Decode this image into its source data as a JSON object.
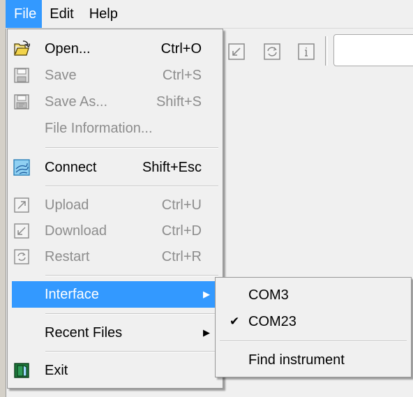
{
  "menubar": {
    "items": [
      {
        "label": "File"
      },
      {
        "label": "Edit"
      },
      {
        "label": "Help"
      }
    ]
  },
  "file_menu": {
    "open": {
      "label": "Open...",
      "shortcut": "Ctrl+O"
    },
    "save": {
      "label": "Save",
      "shortcut": "Ctrl+S"
    },
    "save_as": {
      "label": "Save As...",
      "shortcut": "Shift+S"
    },
    "file_information": {
      "label": "File Information..."
    },
    "connect": {
      "label": "Connect",
      "shortcut": "Shift+Esc"
    },
    "upload": {
      "label": "Upload",
      "shortcut": "Ctrl+U"
    },
    "download": {
      "label": "Download",
      "shortcut": "Ctrl+D"
    },
    "restart": {
      "label": "Restart",
      "shortcut": "Ctrl+R"
    },
    "interface": {
      "label": "Interface"
    },
    "recent_files": {
      "label": "Recent Files"
    },
    "exit": {
      "label": "Exit"
    }
  },
  "interface_submenu": {
    "items": [
      {
        "label": "COM3",
        "checked": false
      },
      {
        "label": "COM23",
        "checked": true
      }
    ],
    "find": {
      "label": "Find instrument"
    }
  },
  "colors": {
    "highlight": "#3399ff",
    "menu_bg": "#f0f0f0",
    "disabled_text": "#8d8d8d"
  }
}
